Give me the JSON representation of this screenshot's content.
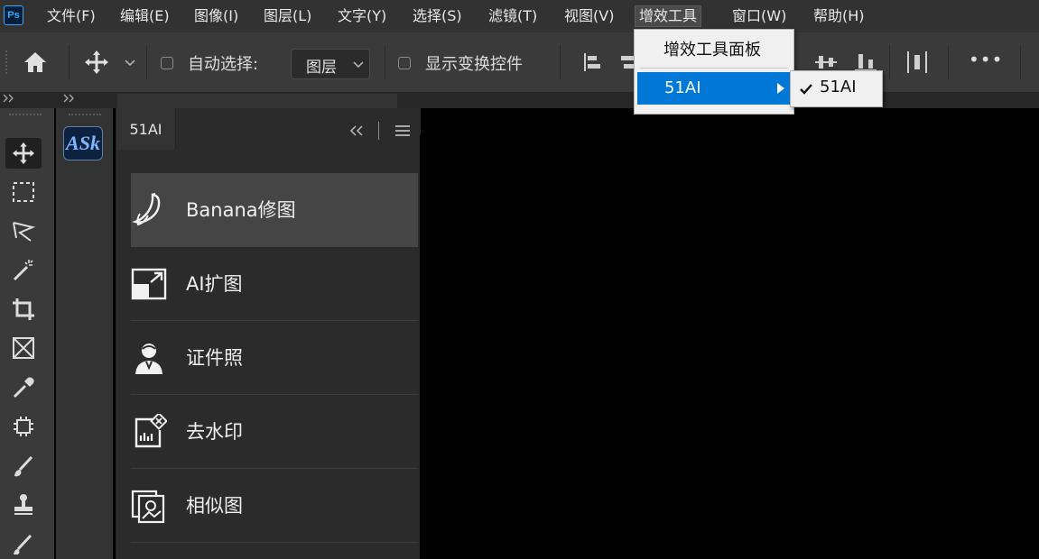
{
  "app": {
    "logo": "Ps"
  },
  "menubar": {
    "items": [
      "文件(F)",
      "编辑(E)",
      "图像(I)",
      "图层(L)",
      "文字(Y)",
      "选择(S)",
      "滤镜(T)",
      "视图(V)",
      "增效工具",
      "窗口(W)",
      "帮助(H)"
    ],
    "active_index": 8
  },
  "options": {
    "auto_select_label": "自动选择:",
    "auto_select_checked": false,
    "layer_select_value": "图层",
    "show_transform_label": "显示变换控件",
    "show_transform_checked": false,
    "more_label": "•••"
  },
  "plugins_menu": {
    "items": [
      {
        "label": "增效工具面板"
      },
      {
        "label": "51AI",
        "has_submenu": true,
        "highlighted": true
      }
    ],
    "submenu": {
      "items": [
        {
          "label": "51AI",
          "checked": true
        }
      ]
    }
  },
  "plugin_panel": {
    "tab_label": "51AI",
    "icon_label": "ASk",
    "features": [
      {
        "label": "Banana修图",
        "icon": "banana-icon",
        "selected": true
      },
      {
        "label": "AI扩图",
        "icon": "expand-image-icon",
        "selected": false
      },
      {
        "label": "证件照",
        "icon": "id-photo-icon",
        "selected": false
      },
      {
        "label": "去水印",
        "icon": "remove-watermark-icon",
        "selected": false
      },
      {
        "label": "相似图",
        "icon": "similar-image-icon",
        "selected": false
      }
    ]
  },
  "colors": {
    "menubar_bg": "#323232",
    "options_bg": "#3a3a3a",
    "panel_bg": "#2b2b2b",
    "selected_item_bg": "#454545",
    "menu_highlight": "#0078d7",
    "canvas_bg": "#000000"
  }
}
